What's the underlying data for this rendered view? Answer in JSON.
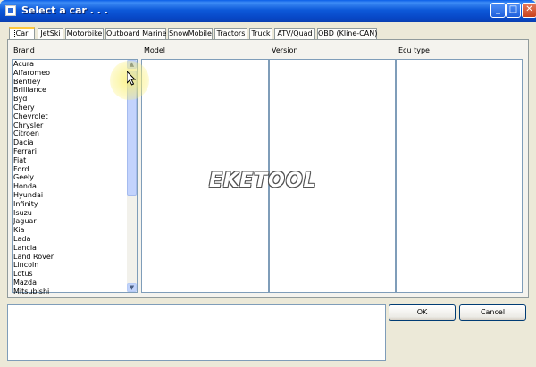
{
  "window": {
    "title": "Select a car . . ."
  },
  "tabs": [
    {
      "label": "Car",
      "active": true
    },
    {
      "label": "JetSki"
    },
    {
      "label": "Motorbike"
    },
    {
      "label": "Outboard Marine"
    },
    {
      "label": "SnowMobile"
    },
    {
      "label": "Tractors"
    },
    {
      "label": "Truck"
    },
    {
      "label": "ATV/Quad"
    },
    {
      "label": "OBD (Kline-CAN)"
    }
  ],
  "columns": {
    "brand": "Brand",
    "model": "Model",
    "version": "Version",
    "ecu_type": "Ecu type"
  },
  "brands": [
    "Acura",
    "Alfaromeo",
    "Bentley",
    "Brilliance",
    "Byd",
    "Chery",
    "Chevrolet",
    "Chrysler",
    "Citroen",
    "Dacia",
    "Ferrari",
    "Fiat",
    "Ford",
    "Geely",
    "Honda",
    "Hyundai",
    "Infinity",
    "Isuzu",
    "Jaguar",
    "Kia",
    "Lada",
    "Lancia",
    "Land Rover",
    "Lincoln",
    "Lotus",
    "Mazda",
    "Mitsubishi"
  ],
  "watermark": "EKETOOL",
  "buttons": {
    "ok": "OK",
    "cancel": "Cancel"
  },
  "colors": {
    "titlebar": "#0a5fe8",
    "active_tab_accent": "#ffc83c",
    "dialog_bg": "#ece9d8"
  }
}
